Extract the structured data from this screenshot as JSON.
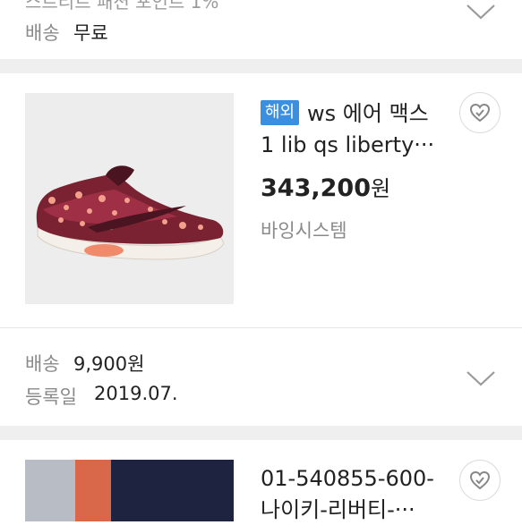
{
  "prev_item": {
    "partial_text": "스트리트 패션 포인트 1%",
    "shipping_label": "배송",
    "shipping_value": "무료"
  },
  "item1": {
    "badge": "해외",
    "title_line1": "ws 에어 맥스",
    "title_line2": "1 lib qs liberty···",
    "price": "343,200",
    "currency": "원",
    "seller": "바잉시스템",
    "shipping_label": "배송",
    "shipping_value": "9,900원",
    "registered_label": "등록일",
    "registered_value": "2019.07."
  },
  "item2": {
    "title_line1": "01-540855-600-",
    "title_line2": "나이키-리버티-···"
  },
  "colors": {
    "badge": "#3b8fe0",
    "separator": "#efefef",
    "muted_text": "#8a8a8a"
  },
  "icons": [
    "chevron-down-icon",
    "heart-icon"
  ]
}
